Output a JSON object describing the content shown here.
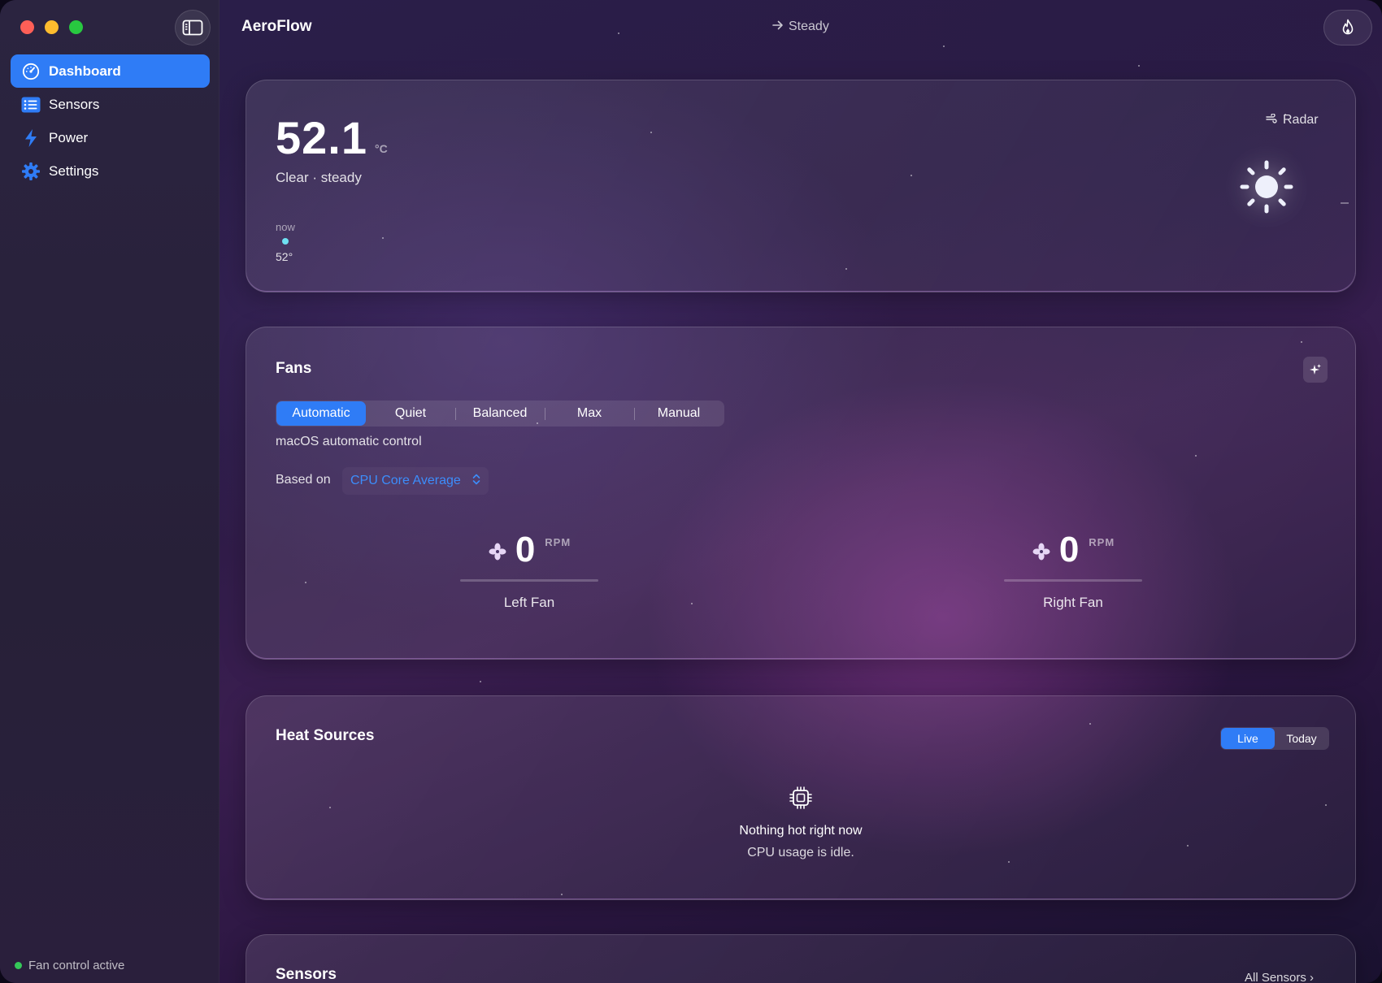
{
  "app": {
    "title": "AeroFlow",
    "status": "Steady"
  },
  "sidebar": {
    "items": [
      {
        "id": "dashboard",
        "label": "Dashboard",
        "icon": "gauge-icon",
        "active": true
      },
      {
        "id": "sensors",
        "label": "Sensors",
        "icon": "list-icon",
        "active": false
      },
      {
        "id": "power",
        "label": "Power",
        "icon": "bolt-icon",
        "active": false
      },
      {
        "id": "settings",
        "label": "Settings",
        "icon": "gear-icon",
        "active": false
      }
    ],
    "footer_status": "Fan control active"
  },
  "temperature_card": {
    "value": "52.1",
    "unit": "°C",
    "condition": "Clear · steady",
    "radar_label": "Radar",
    "timeline": {
      "label": "now",
      "value": "52°"
    }
  },
  "fans_card": {
    "title": "Fans",
    "modes": [
      "Automatic",
      "Quiet",
      "Balanced",
      "Max",
      "Manual"
    ],
    "selected_mode": "Automatic",
    "mode_description": "macOS automatic control",
    "based_on_label": "Based on",
    "based_on_value": "CPU Core Average",
    "fans": [
      {
        "name": "Left Fan",
        "rpm": "0",
        "unit": "RPM"
      },
      {
        "name": "Right Fan",
        "rpm": "0",
        "unit": "RPM"
      }
    ]
  },
  "heat_sources_card": {
    "title": "Heat Sources",
    "tabs": [
      "Live",
      "Today"
    ],
    "active_tab": "Live",
    "empty_title": "Nothing hot right now",
    "empty_subtitle": "CPU usage is idle."
  },
  "sensors_card": {
    "title": "Sensors",
    "link_label": "All Sensors ›"
  },
  "colors": {
    "accent": "#2f7cf6",
    "status_ok": "#35c759",
    "link": "#3c8dfb"
  }
}
